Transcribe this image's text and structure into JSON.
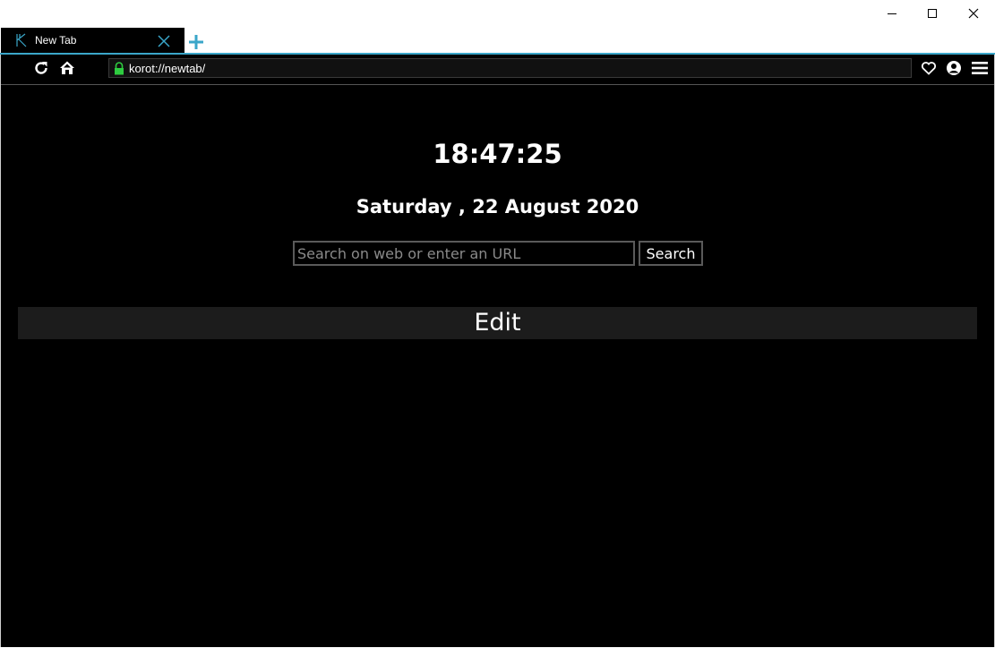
{
  "window": {
    "minimize_icon": "minimize-icon",
    "maximize_icon": "maximize-icon",
    "close_icon": "close-icon"
  },
  "tabs": [
    {
      "title": "New Tab",
      "icon": "korot-logo-icon",
      "active": true
    }
  ],
  "toolbar": {
    "address": "korot://newtab/",
    "icons": [
      "refresh-icon",
      "home-icon",
      "lock-icon",
      "heart-icon",
      "profile-icon",
      "menu-icon"
    ]
  },
  "newtab": {
    "time": "18:47:25",
    "date": "Saturday , 22 August 2020",
    "search_placeholder": "Search on web or enter an URL",
    "search_label": "Search",
    "edit_label": "Edit"
  },
  "colors": {
    "accent": "#3aa6c9",
    "background": "#000000",
    "lock": "#2ecc40"
  }
}
